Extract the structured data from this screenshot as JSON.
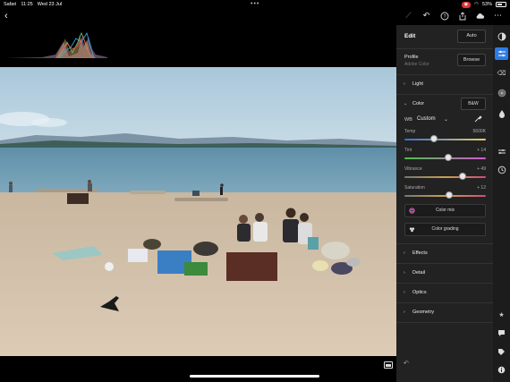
{
  "status": {
    "app": "Safari",
    "time": "11:25",
    "date": "Wed 23 Jul",
    "dots": "•••",
    "battery_pct": "53%"
  },
  "toolbar": {
    "back": "‹",
    "icons": [
      "magic-wand-icon",
      "undo-icon",
      "help-icon",
      "share-icon",
      "cloud-icon",
      "more-icon"
    ]
  },
  "panel": {
    "title": "Edit",
    "auto_label": "Auto",
    "profile_label": "Profile",
    "profile_value": "Adobe Color",
    "browse_label": "Browse",
    "sections_top": [
      {
        "label": "Light",
        "expanded": false
      }
    ],
    "color": {
      "label": "Color",
      "bw_label": "B&W",
      "wb_label": "WB",
      "wb_value": "Custom",
      "sliders": [
        {
          "label": "Temp",
          "value": "5600K",
          "pos": 0.36
        },
        {
          "label": "Tint",
          "value": "+ 14",
          "pos": 0.54
        },
        {
          "label": "Vibrance",
          "value": "+ 49",
          "pos": 0.71
        },
        {
          "label": "Saturation",
          "value": "+ 12",
          "pos": 0.55
        }
      ],
      "color_mix_label": "Color mix",
      "color_grading_label": "Color grading"
    },
    "sections_bottom": [
      {
        "label": "Effects"
      },
      {
        "label": "Detail"
      },
      {
        "label": "Optics"
      },
      {
        "label": "Geometry"
      }
    ]
  },
  "rail": {
    "top_icons": [
      "presets-icon",
      "edit-sliders-icon",
      "healing-icon",
      "masking-icon",
      "color-drop-icon",
      "versions-icon",
      "history-icon"
    ],
    "bottom_icons": [
      "star-icon",
      "comment-icon",
      "tag-icon",
      "info-icon"
    ]
  },
  "colors": {
    "accent": "#2d7be5",
    "panel_bg": "#222222",
    "rail_bg": "#1c1c1c"
  }
}
